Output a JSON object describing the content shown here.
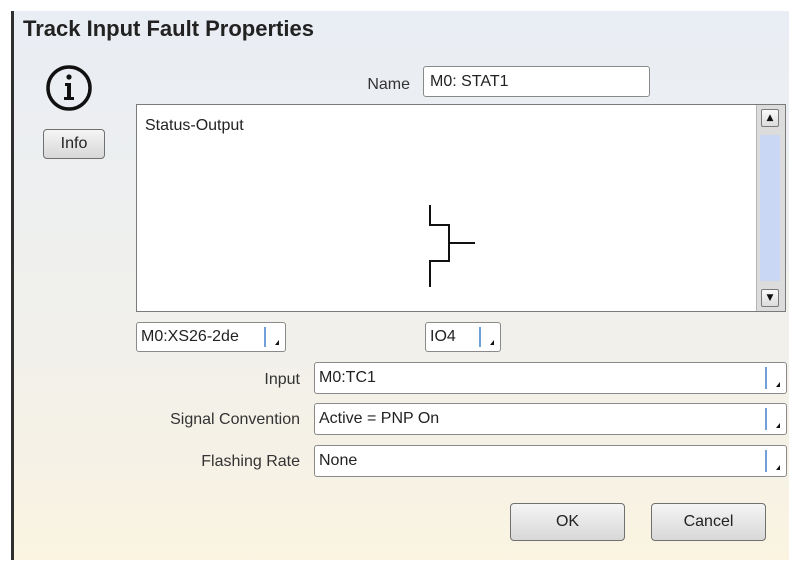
{
  "dialog": {
    "title": "Track Input Fault Properties",
    "info_button": "Info",
    "name_label": "Name",
    "name_value": "M0: STAT1",
    "status_panel": {
      "title": "Status-Output"
    },
    "module_combo": "M0:XS26-2de",
    "io_combo": "IO4",
    "fields": [
      {
        "label": "Input",
        "value": "M0:TC1"
      },
      {
        "label": "Signal Convention",
        "value": "Active = PNP On"
      },
      {
        "label": "Flashing Rate",
        "value": "None"
      }
    ],
    "ok_button": "OK",
    "cancel_button": "Cancel"
  },
  "icons": {
    "info": "info-circle-icon",
    "scroll_up": "scroll-up-icon",
    "scroll_down": "scroll-down-icon",
    "combo_arrow": "dropdown-arrow-icon",
    "output_symbol": "status-output-symbol-icon"
  }
}
